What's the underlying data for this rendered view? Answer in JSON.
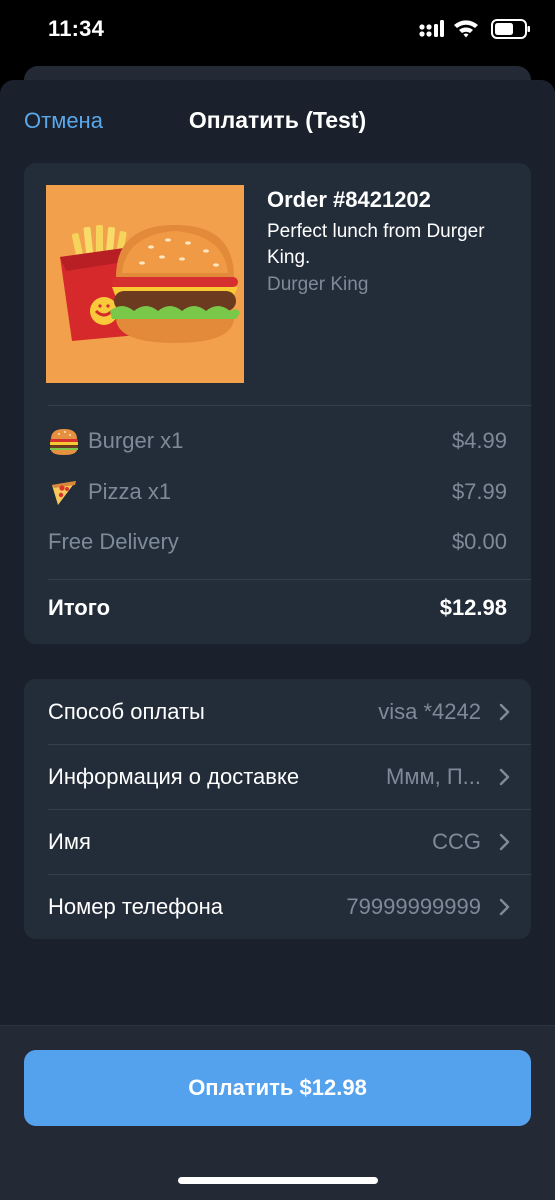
{
  "status_bar": {
    "time": "11:34",
    "icons": [
      "cellular-signal-icon",
      "wifi-icon",
      "battery-icon"
    ]
  },
  "nav": {
    "cancel_label": "Отмена",
    "title": "Оплатить (Test)"
  },
  "order": {
    "title": "Order #8421202",
    "description": "Perfect lunch from Durger King.",
    "merchant": "Durger King",
    "image": "burger-and-fries-illustration",
    "items": [
      {
        "icon": "burger-emoji",
        "label": "Burger x1",
        "price": "$4.99"
      },
      {
        "icon": "pizza-emoji",
        "label": "Pizza x1",
        "price": "$7.99"
      },
      {
        "icon": "",
        "label": "Free Delivery",
        "price": "$0.00"
      }
    ],
    "total_label": "Итого",
    "total_price": "$12.98"
  },
  "info": {
    "rows": [
      {
        "label": "Способ оплаты",
        "value": "visa *4242"
      },
      {
        "label": "Информация о доставке",
        "value": "Ммм, П..."
      },
      {
        "label": "Имя",
        "value": "CCG"
      },
      {
        "label": "Номер телефона",
        "value": "79999999999"
      }
    ]
  },
  "pay_button_label": "Оплатить $12.98",
  "colors": {
    "accent": "#5aa7ea",
    "button": "#54a1ee",
    "sheet_bg": "#1a212c",
    "card_bg": "#232d3a",
    "secondary_text": "#7e8a98"
  }
}
